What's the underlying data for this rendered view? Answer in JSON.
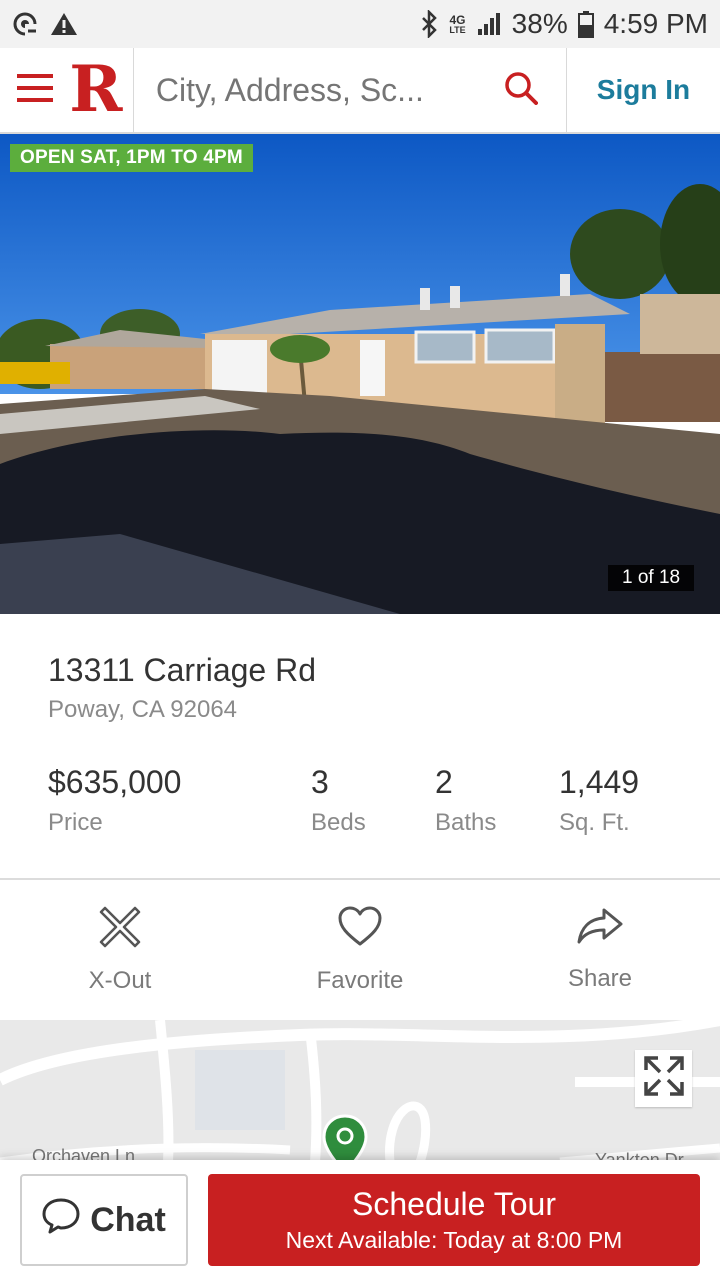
{
  "status_bar": {
    "left_icons": [
      "data-saver-icon",
      "warning-icon"
    ],
    "right_icons": [
      "bluetooth-icon",
      "lte-4g-icon",
      "signal-icon",
      "battery-icon"
    ],
    "network_label": "4G",
    "network_sub": "LTE",
    "battery": "38%",
    "time": "4:59 PM"
  },
  "header": {
    "logo": "R",
    "search_placeholder": "City, Address, Sc...",
    "sign_in": "Sign In",
    "brand_color": "#c82021",
    "link_color": "#1c7c9c"
  },
  "listing": {
    "open_house": "OPEN SAT, 1PM TO 4PM",
    "photo_counter": "1 of 18",
    "address": "13311 Carriage Rd",
    "city_line": "Poway, CA 92064",
    "stats": [
      {
        "value": "$635,000",
        "label": "Price"
      },
      {
        "value": "3",
        "label": "Beds"
      },
      {
        "value": "2",
        "label": "Baths"
      },
      {
        "value": "1,449",
        "label": "Sq. Ft."
      }
    ]
  },
  "actions": [
    {
      "label": "X-Out",
      "icon": "x-out-icon"
    },
    {
      "label": "Favorite",
      "icon": "heart-icon"
    },
    {
      "label": "Share",
      "icon": "share-icon"
    }
  ],
  "map": {
    "street_left": "Orchaven Ln",
    "street_right": "Yankton Dr"
  },
  "bottom": {
    "chat": "Chat",
    "schedule": "Schedule Tour",
    "next_available": "Next Available: Today at 8:00 PM"
  }
}
